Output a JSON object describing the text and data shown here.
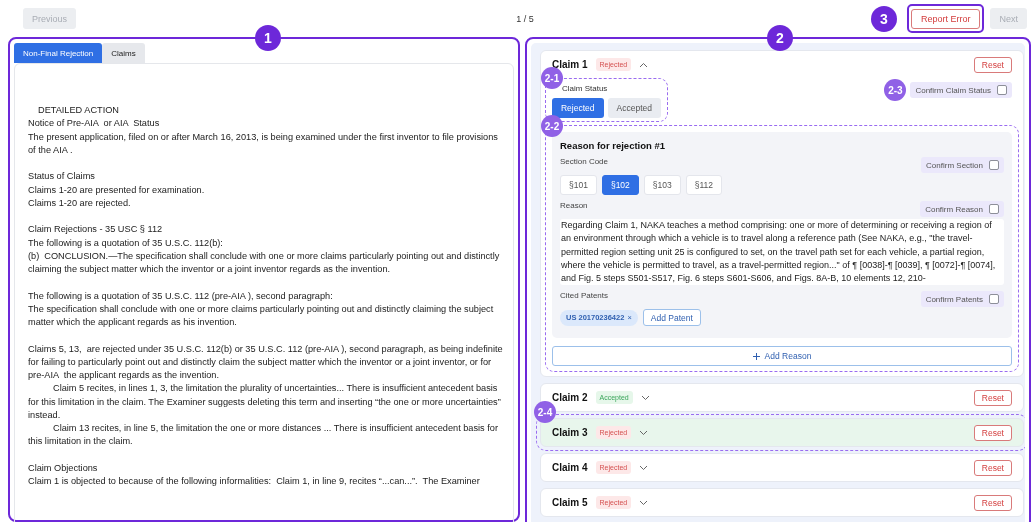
{
  "top_bar": {
    "previous": {
      "label": "Previous",
      "disabled": true
    },
    "page_indicator": "1 / 5",
    "marker": "3",
    "report_error": "Report Error",
    "next": {
      "label": "Next",
      "disabled": true
    }
  },
  "document_panel": {
    "marker": "1",
    "tabs": [
      {
        "label": "Non-Final Rejection",
        "selected": true
      },
      {
        "label": "Claims",
        "selected": false
      }
    ],
    "blocks": [
      {
        "paragraphs": [
          {
            "kind": "heading",
            "text": "DETAILED ACTION"
          },
          {
            "kind": "plain",
            "text": "Notice of Pre-AIA  or AIA  Status"
          },
          {
            "kind": "plain",
            "text": "The present application, filed on or after March 16, 2013, is being examined under the first inventor to file provisions of the AIA ."
          }
        ]
      },
      {
        "paragraphs": [
          {
            "kind": "plain",
            "text": "Status of Claims"
          },
          {
            "kind": "plain",
            "text": "Claims 1-20 are presented for examination."
          },
          {
            "kind": "plain",
            "text": "Claims 1-20 are rejected."
          }
        ]
      },
      {
        "paragraphs": [
          {
            "kind": "plain",
            "text": "Claim Rejections - 35 USC § 112"
          },
          {
            "kind": "plain",
            "text": "The following is a quotation of 35 U.S.C. 112(b):"
          },
          {
            "kind": "plain",
            "text": "(b)  CONCLUSION.—The specification shall conclude with one or more claims particularly pointing out and distinctly claiming the subject matter which the inventor or a joint inventor regards as the invention."
          }
        ]
      },
      {
        "paragraphs": [
          {
            "kind": "plain",
            "text": "The following is a quotation of 35 U.S.C. 112 (pre-AIA ), second paragraph:"
          },
          {
            "kind": "plain",
            "text": "The specification shall conclude with one or more claims particularly pointing out and distinctly claiming the subject matter which the applicant regards as his invention."
          }
        ]
      },
      {
        "paragraphs": [
          {
            "kind": "plain",
            "text": "Claims 5, 13,  are rejected under 35 U.S.C. 112(b) or 35 U.S.C. 112 (pre-AIA ), second paragraph, as being indefinite for failing to particularly point out and distinctly claim the subject matter which the inventor or a joint inventor, or for pre-AIA  the applicant regards as the invention."
          },
          {
            "kind": "indented",
            "text": "Claim 5 recites, in lines 1, 3, the limitation the plurality of uncertainties... There is insufficient antecedent basis for this limitation in the claim. The Examiner suggests deleting this term and inserting “the one or more uncertainties” instead."
          },
          {
            "kind": "indented",
            "text": "Claim 13 recites, in line 5, the limitation the one or more distances ... There is insufficient antecedent basis for this limitation in the claim."
          }
        ]
      },
      {
        "paragraphs": [
          {
            "kind": "plain",
            "text": "Claim Objections"
          },
          {
            "kind": "plain",
            "text": "Claim 1 is objected to because of the following informalities:  Claim 1, in line 9, recites “...can...”.  The Examiner"
          }
        ]
      }
    ]
  },
  "claims_panel": {
    "marker": "2",
    "claims": [
      {
        "title": "Claim 1",
        "status": "Rejected",
        "kind": "rejected",
        "expanded": true,
        "selected": false,
        "reset": "Reset",
        "detail": {
          "status_group": {
            "marker": "2-1",
            "label": "Claim Status",
            "options": [
              {
                "label": "Rejected",
                "selected": true
              },
              {
                "label": "Accepted",
                "selected": false
              }
            ]
          },
          "confirm_status": {
            "marker": "2-3",
            "label": "Confirm Claim Status",
            "checked": false
          },
          "reasons_group": {
            "marker": "2-2",
            "add_reason": "Add Reason",
            "reasons": [
              {
                "title": "Reason for rejection #1",
                "section_label": "Section Code",
                "confirm_section": {
                  "label": "Confirm Section",
                  "checked": false
                },
                "sections": [
                  {
                    "label": "§101",
                    "selected": false
                  },
                  {
                    "label": "§102",
                    "selected": true
                  },
                  {
                    "label": "§103",
                    "selected": false
                  },
                  {
                    "label": "§112",
                    "selected": false
                  }
                ],
                "reason_label": "Reason",
                "confirm_reason": {
                  "label": "Confirm Reason",
                  "checked": false
                },
                "reason_value": "Regarding Claim 1, NAKA teaches a method comprising: one or more of determining or receiving a region of an environment through which a vehicle is to travel along a reference path (See NAKA, e.g., \"the travel-permitted region setting unit 25 is configured to set, on the travel path set for each vehicle, a partial region, where the vehicle is permitted to travel, as a travel-permitted region...\" of ¶ [0038]-¶ [0039], ¶ [0072]-¶ [0074], and Fig. 5 steps S501-S517, Fig. 6 steps S601-S606, and Figs. 8A-B, 10 elements 12, 210-",
                "patents_label": "Cited Patents",
                "confirm_patents": {
                  "label": "Confirm Patents",
                  "checked": false
                },
                "patents": [
                  {
                    "number": "US 20170236422",
                    "remove": "×"
                  }
                ],
                "add_patent": "Add Patent"
              }
            ]
          }
        }
      },
      {
        "title": "Claim 2",
        "status": "Accepted",
        "kind": "accepted",
        "expanded": false,
        "selected": false,
        "reset": "Reset"
      },
      {
        "title": "Claim 3",
        "status": "Rejected",
        "kind": "rejected",
        "expanded": false,
        "selected": true,
        "reset": "Reset",
        "marker": "2-4"
      },
      {
        "title": "Claim 4",
        "status": "Rejected",
        "kind": "rejected",
        "expanded": false,
        "selected": false,
        "reset": "Reset"
      },
      {
        "title": "Claim 5",
        "status": "Rejected",
        "kind": "rejected",
        "expanded": false,
        "selected": false,
        "reset": "Reset"
      }
    ]
  }
}
